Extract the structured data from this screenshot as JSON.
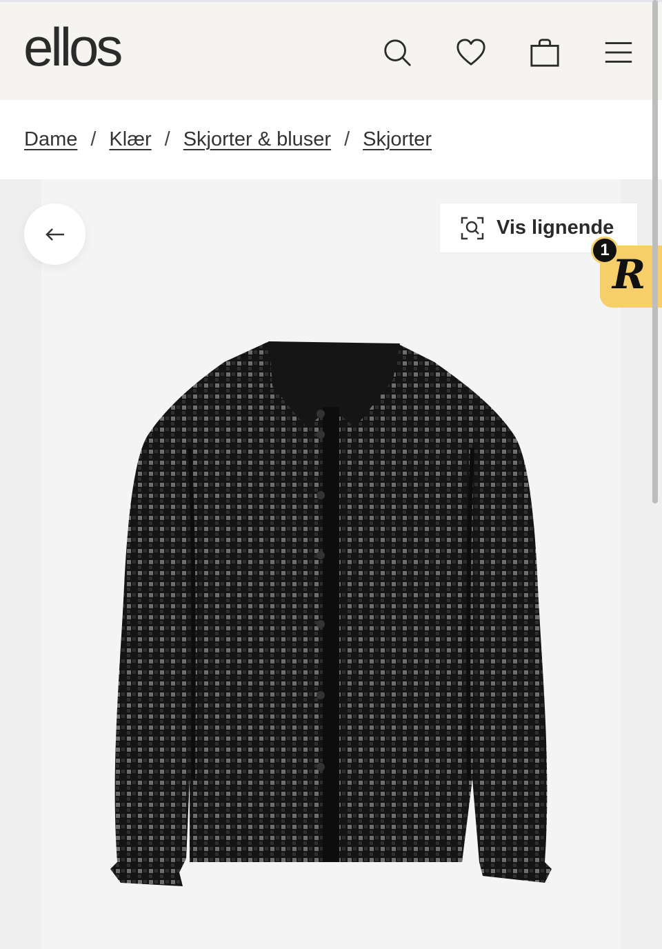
{
  "header": {
    "logo": "ellos",
    "icons": [
      "search-icon",
      "heart-icon",
      "bag-icon",
      "menu-icon"
    ]
  },
  "breadcrumb": {
    "items": [
      "Dame",
      "Klær",
      "Skjorter & bluser",
      "Skjorter"
    ],
    "separator": "/"
  },
  "gallery": {
    "similar_label": "Vis lignende",
    "product_alt": "Svart rutete skjorte"
  },
  "widget": {
    "badge": "1",
    "letter": "R"
  },
  "colors": {
    "header_bg": "#f5f4f0",
    "widget_bg": "#f6cf6a",
    "shirt": "#1c1c1c"
  }
}
